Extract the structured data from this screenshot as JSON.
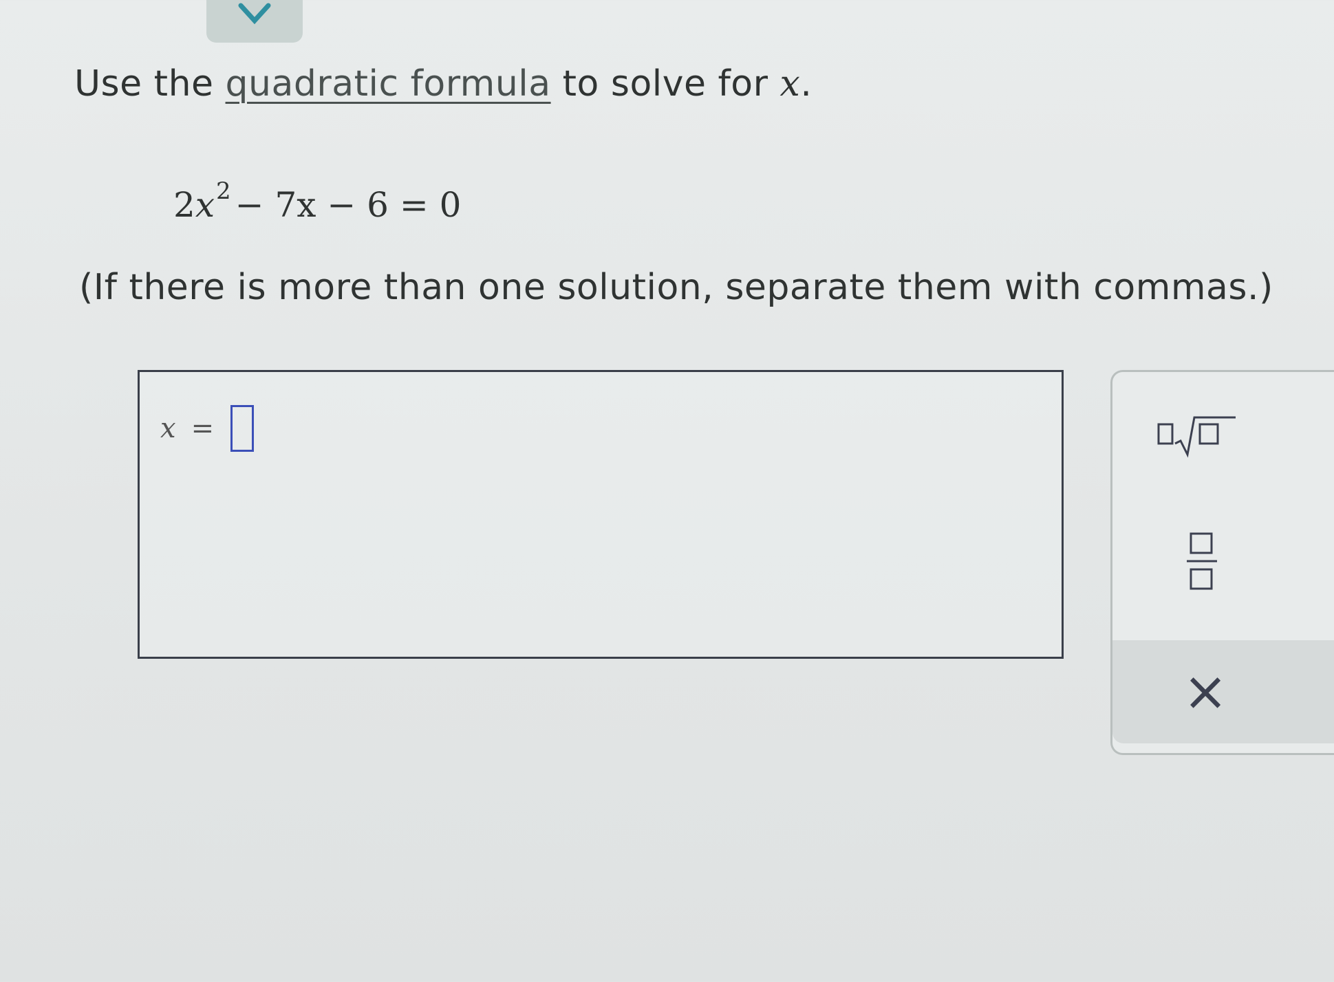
{
  "header": {
    "collapse_icon": "chevron-down-icon"
  },
  "question": {
    "instruction_prefix": "Use the ",
    "instruction_link": "quadratic formula",
    "instruction_suffix": " to solve for ",
    "instruction_var": "x",
    "instruction_end": ".",
    "equation": {
      "coef_a": "2",
      "var": "x",
      "exponent": "2",
      "rest": "− 7x − 6 = 0"
    },
    "note": "(If there is more than one solution, separate them with commas.)"
  },
  "answer": {
    "variable": "x",
    "equals": "=",
    "value": ""
  },
  "palette": {
    "buttons": [
      "nth-root-template-icon",
      "fraction-template-icon",
      "partial-template-icon"
    ],
    "clear_label": "×"
  }
}
